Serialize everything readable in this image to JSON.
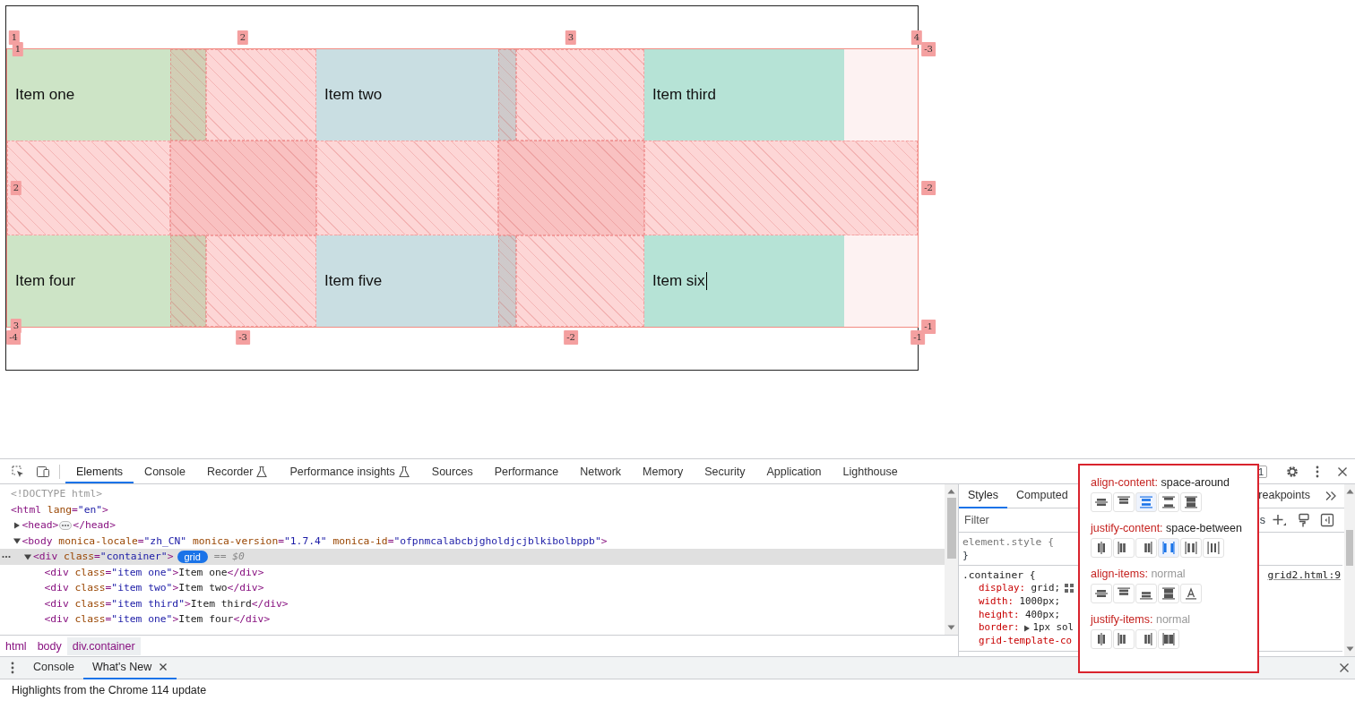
{
  "grid_preview": {
    "items": [
      {
        "text": "Item one",
        "color": "#cde4c6",
        "cursor": false
      },
      {
        "text": "Item two",
        "color": "#c9dee2",
        "cursor": false
      },
      {
        "text": "Item third",
        "color": "#b6e3d6",
        "cursor": false
      },
      {
        "text": "Item four",
        "color": "#cde4c6",
        "cursor": false
      },
      {
        "text": "Item five",
        "color": "#c9dee2",
        "cursor": false
      },
      {
        "text": "Item six",
        "color": "#b6e3d6",
        "cursor": true
      }
    ],
    "line_labels": [
      "1",
      "1",
      "2",
      "3",
      "4",
      "-3",
      "2",
      "-2",
      "3",
      "-4",
      "-3",
      "-2",
      "-1",
      "-1"
    ]
  },
  "devtools": {
    "tabs": [
      {
        "label": "Elements",
        "selected": true,
        "experimental": false
      },
      {
        "label": "Console",
        "selected": false,
        "experimental": false
      },
      {
        "label": "Recorder",
        "selected": false,
        "experimental": true
      },
      {
        "label": "Performance insights",
        "selected": false,
        "experimental": true
      },
      {
        "label": "Sources",
        "selected": false,
        "experimental": false
      },
      {
        "label": "Performance",
        "selected": false,
        "experimental": false
      },
      {
        "label": "Network",
        "selected": false,
        "experimental": false
      },
      {
        "label": "Memory",
        "selected": false,
        "experimental": false
      },
      {
        "label": "Security",
        "selected": false,
        "experimental": false
      },
      {
        "label": "Application",
        "selected": false,
        "experimental": false
      },
      {
        "label": "Lighthouse",
        "selected": false,
        "experimental": false
      }
    ],
    "issues_count": "1",
    "dom_tree": [
      {
        "text": "<!DOCTYPE html>",
        "kind": "doctype",
        "selected": false
      },
      {
        "text": "<html lang=\"en\">",
        "kind": "code",
        "selected": false,
        "children": [
          {
            "text": "<head>",
            "kind": "code",
            "selected": false,
            "expanded": false,
            "closing": "</head>"
          },
          {
            "text": "<body monica-locale=\"zh_CN\" monica-version=\"1.7.4\" monica-id=\"ofpnmcalabcbjgholdjcjblkibolbppb\">",
            "kind": "code",
            "selected": false,
            "expanded": true,
            "children": [
              {
                "text": "<div class=\"container\">",
                "kind": "code",
                "selected": true,
                "expanded": true,
                "badge": "grid",
                "suffix": "== $0",
                "children": [
                  {
                    "text": "<div class=\"item one\">Item one</div>",
                    "kind": "code",
                    "selected": false
                  },
                  {
                    "text": "<div class=\"item two\">Item two</div>",
                    "kind": "code",
                    "selected": false
                  },
                  {
                    "text": "<div class=\"item third\">Item third</div>",
                    "kind": "code",
                    "selected": false
                  },
                  {
                    "text": "<div class=\"item one\">Item four</div>",
                    "kind": "code",
                    "selected": false
                  }
                ]
              }
            ]
          }
        ]
      }
    ],
    "breadcrumbs": [
      {
        "label": "html",
        "selected": false
      },
      {
        "label": "body",
        "selected": false
      },
      {
        "label": "div.container",
        "selected": true
      }
    ],
    "styles_pane": {
      "tabs": [
        {
          "label": "Styles",
          "selected": true
        },
        {
          "label": "Computed",
          "selected": false
        }
      ],
      "trailing_tab": {
        "label": "reakpoints",
        "selected": false
      },
      "filter": {
        "placeholder": "Filter"
      },
      "toolbar_text": "s",
      "rules": [
        {
          "selector": "element.style {",
          "closing": "}"
        },
        {
          "selector": ".container {",
          "source": "grid2.html:9",
          "declarations": [
            {
              "name": "display:",
              "value": "grid;",
              "grid_editor": true,
              "expandable": false
            },
            {
              "name": "width:",
              "value": "1000px;",
              "grid_editor": false,
              "expandable": false
            },
            {
              "name": "height:",
              "value": "400px;",
              "grid_editor": false,
              "expandable": false
            },
            {
              "name": "border:",
              "value": "1px sol",
              "grid_editor": false,
              "expandable": true
            },
            {
              "name": "grid-template-co",
              "grid_editor": false,
              "expandable": false
            }
          ]
        }
      ]
    },
    "grid_editor": {
      "sections": [
        {
          "property": "align-content:",
          "value": "space-around",
          "is_set": true,
          "kind": "vertical",
          "options": [
            {
              "kind": "center",
              "selected": false
            },
            {
              "kind": "start",
              "selected": false
            },
            {
              "kind": "space-around",
              "selected": true
            },
            {
              "kind": "space-between",
              "selected": false
            },
            {
              "kind": "stretch",
              "selected": false
            }
          ]
        },
        {
          "property": "justify-content:",
          "value": "space-between",
          "is_set": true,
          "kind": "horizontal",
          "options": [
            {
              "kind": "center",
              "selected": false
            },
            {
              "kind": "start",
              "selected": false
            },
            {
              "kind": "end",
              "selected": false
            },
            {
              "kind": "space-between",
              "selected": true
            },
            {
              "kind": "space-around",
              "selected": false
            },
            {
              "kind": "space-evenly",
              "selected": false
            }
          ]
        },
        {
          "property": "align-items:",
          "value": "normal",
          "is_set": false,
          "kind": "vertical",
          "options": [
            {
              "kind": "center",
              "selected": false
            },
            {
              "kind": "start",
              "selected": false
            },
            {
              "kind": "end",
              "selected": false
            },
            {
              "kind": "stretch",
              "selected": false
            },
            {
              "kind": "baseline",
              "selected": false
            }
          ]
        },
        {
          "property": "justify-items:",
          "value": "normal",
          "is_set": false,
          "kind": "horizontal",
          "options": [
            {
              "kind": "center",
              "selected": false
            },
            {
              "kind": "start",
              "selected": false
            },
            {
              "kind": "end",
              "selected": false
            },
            {
              "kind": "stretch",
              "selected": false
            }
          ]
        }
      ]
    },
    "drawer": {
      "tabs": [
        {
          "label": "Console",
          "selected": false,
          "closable": false
        },
        {
          "label": "What's New",
          "selected": true,
          "closable": true
        }
      ],
      "content": "Highlights from the Chrome 114 update"
    }
  }
}
